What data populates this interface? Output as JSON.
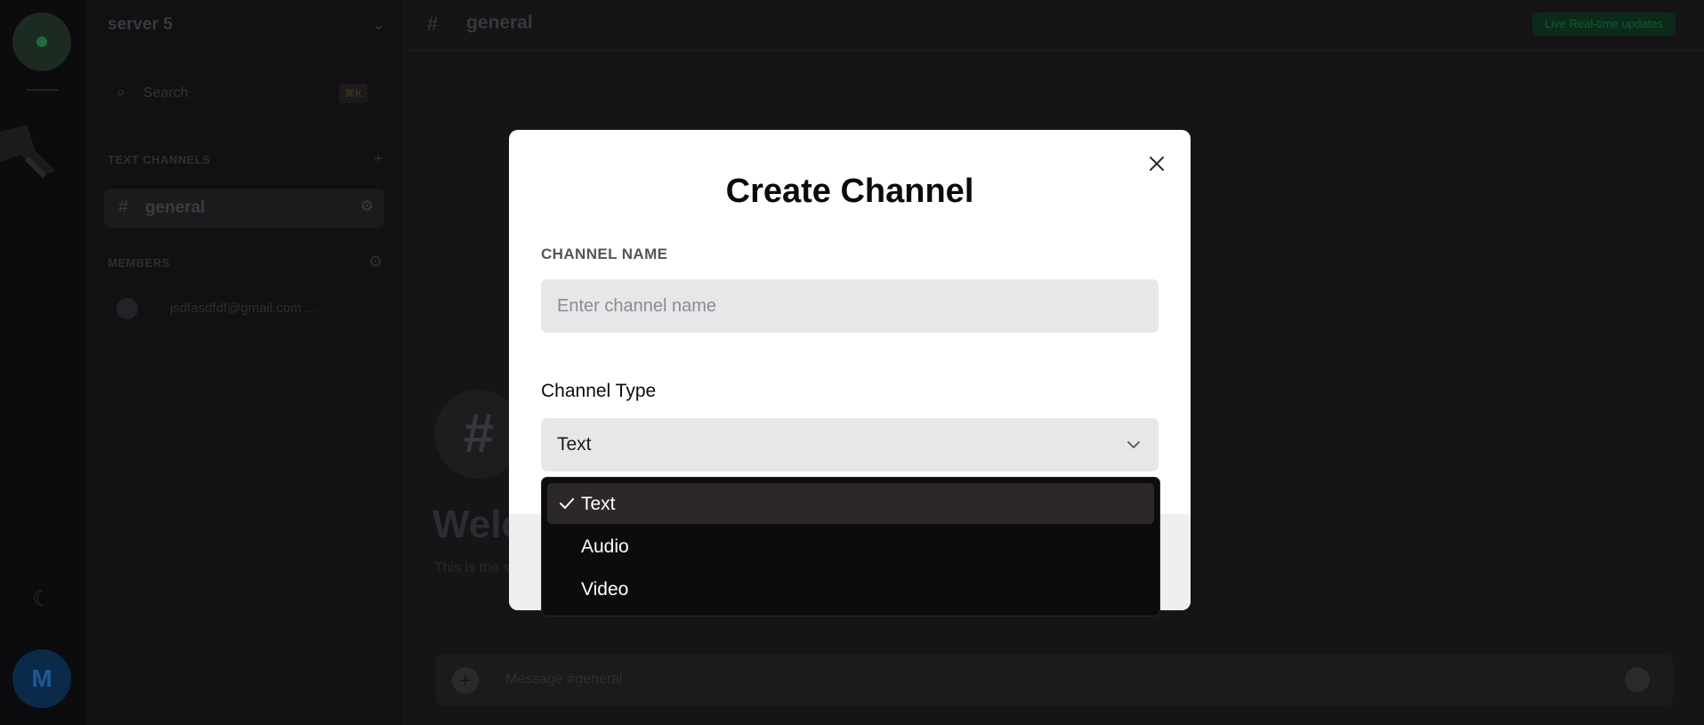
{
  "background": {
    "server": {
      "name": "server 5",
      "search_label": "Search",
      "search_shortcut": "⌘K"
    },
    "sections": {
      "text_channels": "TEXT CHANNELS",
      "members": "MEMBERS"
    },
    "channels": [
      {
        "name": "general"
      }
    ],
    "members": [
      {
        "name": "jsdfasdfdf@gmail.com ..."
      }
    ],
    "topbar": {
      "channel_name": "general",
      "badge_label": "Live Real-time updates"
    },
    "welcome": {
      "hash": "#",
      "title": "Welcome to #general",
      "subtitle": "This is the start of the #general channel."
    },
    "composer": {
      "placeholder": "Message #general"
    },
    "user_avatar_initial": "M"
  },
  "modal": {
    "title": "Create Channel",
    "channel_name_label": "CHANNEL NAME",
    "channel_name_placeholder": "Enter channel name",
    "channel_name_value": "",
    "channel_type_label": "Channel Type",
    "channel_type_value": "Text"
  },
  "dropdown": {
    "options": [
      {
        "label": "Text",
        "selected": true
      },
      {
        "label": "Audio",
        "selected": false
      },
      {
        "label": "Video",
        "selected": false
      }
    ]
  },
  "icons": {
    "close": "close-icon",
    "chevron": "chevron-down-icon",
    "check": "check-icon"
  },
  "colors": {
    "modal_bg": "#ffffff",
    "input_bg": "#e7e7e9",
    "dropdown_bg": "#0d0c0c",
    "dropdown_selected": "#2b2827",
    "app_bg": "#151416"
  }
}
